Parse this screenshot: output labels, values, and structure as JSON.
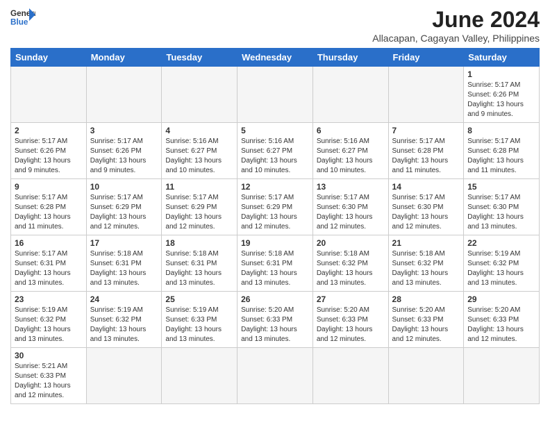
{
  "header": {
    "logo_general": "General",
    "logo_blue": "Blue",
    "month_year": "June 2024",
    "location": "Allacapan, Cagayan Valley, Philippines"
  },
  "days_of_week": [
    "Sunday",
    "Monday",
    "Tuesday",
    "Wednesday",
    "Thursday",
    "Friday",
    "Saturday"
  ],
  "weeks": [
    [
      {
        "day": "",
        "info": ""
      },
      {
        "day": "",
        "info": ""
      },
      {
        "day": "",
        "info": ""
      },
      {
        "day": "",
        "info": ""
      },
      {
        "day": "",
        "info": ""
      },
      {
        "day": "",
        "info": ""
      },
      {
        "day": "1",
        "info": "Sunrise: 5:17 AM\nSunset: 6:26 PM\nDaylight: 13 hours and 9 minutes."
      }
    ],
    [
      {
        "day": "2",
        "info": "Sunrise: 5:17 AM\nSunset: 6:26 PM\nDaylight: 13 hours and 9 minutes."
      },
      {
        "day": "3",
        "info": "Sunrise: 5:17 AM\nSunset: 6:26 PM\nDaylight: 13 hours and 9 minutes."
      },
      {
        "day": "4",
        "info": "Sunrise: 5:16 AM\nSunset: 6:27 PM\nDaylight: 13 hours and 10 minutes."
      },
      {
        "day": "5",
        "info": "Sunrise: 5:16 AM\nSunset: 6:27 PM\nDaylight: 13 hours and 10 minutes."
      },
      {
        "day": "6",
        "info": "Sunrise: 5:16 AM\nSunset: 6:27 PM\nDaylight: 13 hours and 10 minutes."
      },
      {
        "day": "7",
        "info": "Sunrise: 5:17 AM\nSunset: 6:28 PM\nDaylight: 13 hours and 11 minutes."
      },
      {
        "day": "8",
        "info": "Sunrise: 5:17 AM\nSunset: 6:28 PM\nDaylight: 13 hours and 11 minutes."
      }
    ],
    [
      {
        "day": "9",
        "info": "Sunrise: 5:17 AM\nSunset: 6:28 PM\nDaylight: 13 hours and 11 minutes."
      },
      {
        "day": "10",
        "info": "Sunrise: 5:17 AM\nSunset: 6:29 PM\nDaylight: 13 hours and 12 minutes."
      },
      {
        "day": "11",
        "info": "Sunrise: 5:17 AM\nSunset: 6:29 PM\nDaylight: 13 hours and 12 minutes."
      },
      {
        "day": "12",
        "info": "Sunrise: 5:17 AM\nSunset: 6:29 PM\nDaylight: 13 hours and 12 minutes."
      },
      {
        "day": "13",
        "info": "Sunrise: 5:17 AM\nSunset: 6:30 PM\nDaylight: 13 hours and 12 minutes."
      },
      {
        "day": "14",
        "info": "Sunrise: 5:17 AM\nSunset: 6:30 PM\nDaylight: 13 hours and 12 minutes."
      },
      {
        "day": "15",
        "info": "Sunrise: 5:17 AM\nSunset: 6:30 PM\nDaylight: 13 hours and 13 minutes."
      }
    ],
    [
      {
        "day": "16",
        "info": "Sunrise: 5:17 AM\nSunset: 6:31 PM\nDaylight: 13 hours and 13 minutes."
      },
      {
        "day": "17",
        "info": "Sunrise: 5:18 AM\nSunset: 6:31 PM\nDaylight: 13 hours and 13 minutes."
      },
      {
        "day": "18",
        "info": "Sunrise: 5:18 AM\nSunset: 6:31 PM\nDaylight: 13 hours and 13 minutes."
      },
      {
        "day": "19",
        "info": "Sunrise: 5:18 AM\nSunset: 6:31 PM\nDaylight: 13 hours and 13 minutes."
      },
      {
        "day": "20",
        "info": "Sunrise: 5:18 AM\nSunset: 6:32 PM\nDaylight: 13 hours and 13 minutes."
      },
      {
        "day": "21",
        "info": "Sunrise: 5:18 AM\nSunset: 6:32 PM\nDaylight: 13 hours and 13 minutes."
      },
      {
        "day": "22",
        "info": "Sunrise: 5:19 AM\nSunset: 6:32 PM\nDaylight: 13 hours and 13 minutes."
      }
    ],
    [
      {
        "day": "23",
        "info": "Sunrise: 5:19 AM\nSunset: 6:32 PM\nDaylight: 13 hours and 13 minutes."
      },
      {
        "day": "24",
        "info": "Sunrise: 5:19 AM\nSunset: 6:32 PM\nDaylight: 13 hours and 13 minutes."
      },
      {
        "day": "25",
        "info": "Sunrise: 5:19 AM\nSunset: 6:33 PM\nDaylight: 13 hours and 13 minutes."
      },
      {
        "day": "26",
        "info": "Sunrise: 5:20 AM\nSunset: 6:33 PM\nDaylight: 13 hours and 13 minutes."
      },
      {
        "day": "27",
        "info": "Sunrise: 5:20 AM\nSunset: 6:33 PM\nDaylight: 13 hours and 12 minutes."
      },
      {
        "day": "28",
        "info": "Sunrise: 5:20 AM\nSunset: 6:33 PM\nDaylight: 13 hours and 12 minutes."
      },
      {
        "day": "29",
        "info": "Sunrise: 5:20 AM\nSunset: 6:33 PM\nDaylight: 13 hours and 12 minutes."
      }
    ],
    [
      {
        "day": "30",
        "info": "Sunrise: 5:21 AM\nSunset: 6:33 PM\nDaylight: 13 hours and 12 minutes."
      },
      {
        "day": "",
        "info": ""
      },
      {
        "day": "",
        "info": ""
      },
      {
        "day": "",
        "info": ""
      },
      {
        "day": "",
        "info": ""
      },
      {
        "day": "",
        "info": ""
      },
      {
        "day": "",
        "info": ""
      }
    ]
  ]
}
